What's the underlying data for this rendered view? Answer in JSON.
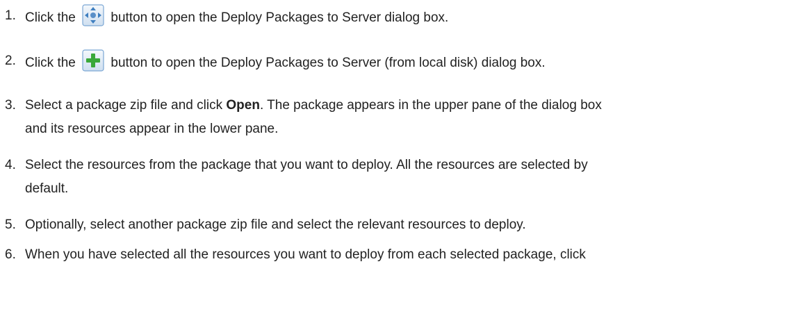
{
  "steps": [
    {
      "num": "1.",
      "pre": "Click the",
      "icon": "deploy-packages-icon",
      "post": "button to open the Deploy Packages to Server dialog box."
    },
    {
      "num": "2.",
      "pre": "Click the",
      "icon": "add-plus-icon",
      "post": "button to open the Deploy Packages to Server (from local disk) dialog box."
    },
    {
      "num": "3.",
      "pre": "Select a package zip file and click",
      "bold": "Open",
      "post": ". The package appears in the upper pane of the dialog box",
      "line2": "and its resources appear in the lower pane."
    },
    {
      "num": "4.",
      "text": "Select the resources from the package that you want to deploy. All the resources are selected by",
      "line2": "default."
    },
    {
      "num": "5.",
      "text": "Optionally, select another package zip file and select the relevant resources to deploy."
    },
    {
      "num": "6.",
      "text": "When you have selected all the resources you want to deploy from each selected package, click"
    }
  ],
  "colors": {
    "text": "#222222",
    "icon_frame": "#7aa6d4",
    "plus_green": "#3aa83a"
  }
}
